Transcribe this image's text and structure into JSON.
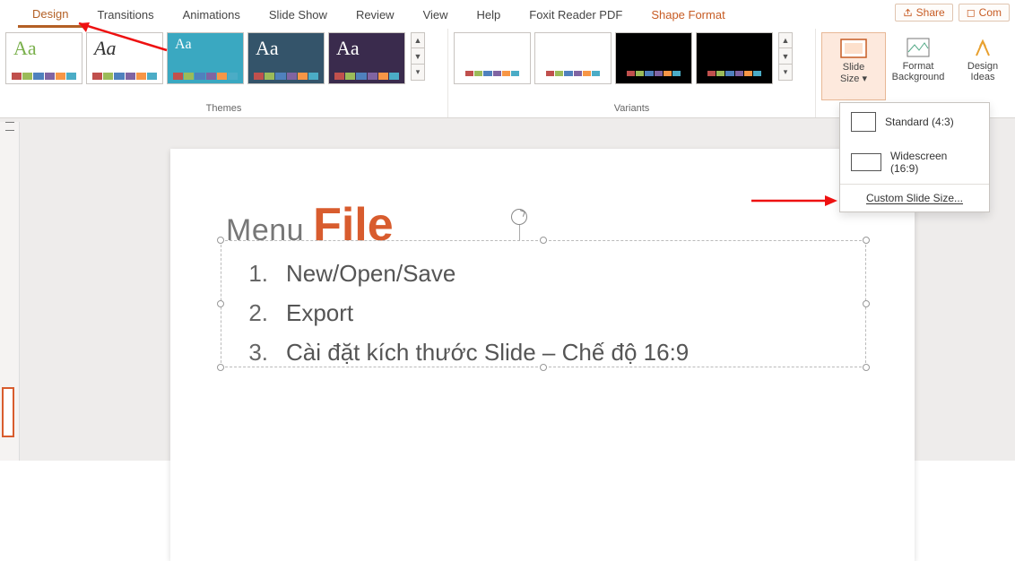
{
  "tabs": {
    "design": "Design",
    "transitions": "Transitions",
    "animations": "Animations",
    "slideshow": "Slide Show",
    "review": "Review",
    "view": "View",
    "help": "Help",
    "foxit": "Foxit Reader PDF",
    "shape_format": "Shape Format"
  },
  "top_actions": {
    "share": "Share",
    "comments": "Com"
  },
  "ribbon": {
    "themes_label": "Themes",
    "variants_label": "Variants",
    "slide_size": "Slide",
    "slide_size2": "Size",
    "format_bg": "Format",
    "format_bg2": "Background",
    "design_ideas": "Design",
    "design_ideas2": "Ideas"
  },
  "dropdown": {
    "standard": "Standard (4:3)",
    "widescreen": "Widescreen (16:9)",
    "custom": "Custom Slide Size..."
  },
  "slide": {
    "title_menu": "Menu",
    "title_file": "File",
    "items": [
      {
        "num": "1.",
        "text": "New/Open/Save"
      },
      {
        "num": "2.",
        "text": "Export"
      },
      {
        "num": "3.",
        "text": "Cài đặt kích thước Slide – Chế độ 16:9"
      }
    ]
  },
  "theme_thumbs": [
    "Aa",
    "Aa",
    "Aa",
    "Aa",
    "Aa"
  ]
}
